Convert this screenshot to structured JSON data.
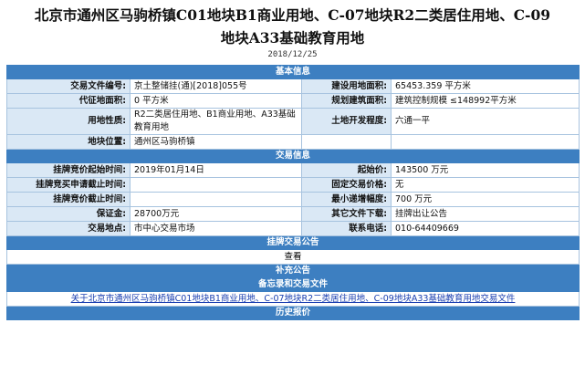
{
  "page": {
    "title_line1": "北京市通州区马驹桥镇C01地块B1商业用地、C-07地块R2二类居住用地、C-09",
    "title_line2": "地块A33基础教育用地",
    "date": "2018/12/25"
  },
  "sections": {
    "basic": "基本信息",
    "trade": "交易信息",
    "listing_notice": "挂牌交易公告",
    "supplement": "补充公告",
    "record": "备忘录和交易文件",
    "history": "历史报价"
  },
  "basic": {
    "file_no_label": "交易文件编号:",
    "file_no": "京土整储挂(通)[2018]055号",
    "build_area_label": "建设用地面积:",
    "build_area": "65453.359 平方米",
    "land_area_label": "代征地面积:",
    "land_area": "0 平方米",
    "plan_area_label": "规划建筑面积:",
    "plan_area": "建筑控制规模 ≤148992平方米",
    "use_label": "用地性质:",
    "use": "R2二类居住用地、B1商业用地、A33基础教育用地",
    "dev_label": "土地开发程度:",
    "dev": "六通一平",
    "location_label": "地块位置:",
    "location": "通州区马驹桥镇"
  },
  "trade": {
    "start_label": "挂牌竞价起始时间:",
    "start": "2019年01月14日",
    "start_price_label": "起始价:",
    "start_price": "143500 万元",
    "apply_end_label": "挂牌竞买申请截止时间:",
    "apply_end": "",
    "fixed_price_label": "固定交易价格:",
    "fixed_price": "无",
    "bid_end_label": "挂牌竞价截止时间:",
    "bid_end": "",
    "min_step_label": "最小递增幅度:",
    "min_step": "700 万元",
    "deposit_label": "保证金:",
    "deposit": "28700万元",
    "other_files_label": "其它文件下载:",
    "other_files": "挂牌出让公告",
    "place_label": "交易地点:",
    "place": "市中心交易市场",
    "phone_label": "联系电话:",
    "phone": "010-64409669"
  },
  "links": {
    "view": "查看",
    "trade_file": "关于北京市通州区马驹桥镇C01地块B1商业用地、C-07地块R2二类居住用地、C-09地块A33基础教育用地交易文件"
  }
}
